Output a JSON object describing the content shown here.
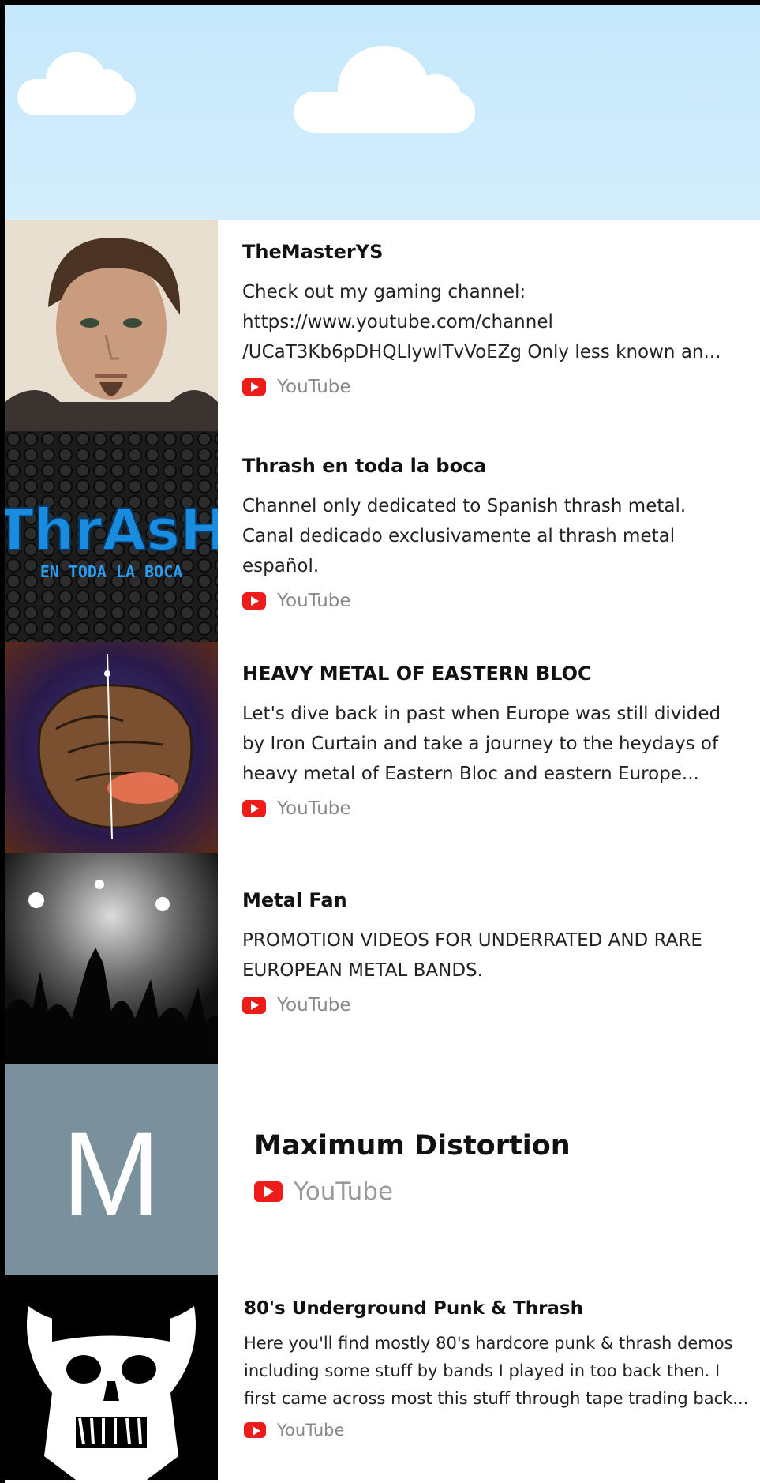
{
  "channels": [
    {
      "title": "TheMasterYS",
      "desc": [
        "Check out my gaming channel:",
        "https://www.youtube.com/channel",
        "/UCaT3Kb6pDHQLlywlTvVoEZg Only less known an..."
      ],
      "source": "YouTube"
    },
    {
      "title": "Thrash en toda la boca",
      "desc": [
        "Channel only dedicated to Spanish thrash metal.",
        "Canal dedicado exclusivamente al thrash metal",
        "español."
      ],
      "source": "YouTube",
      "logo_text": "ThrAsH",
      "logo_sub": "EN TODA LA BOCA"
    },
    {
      "title": "HEAVY METAL OF EASTERN BLOC",
      "desc": [
        "Let's dive back in past when Europe was still divided",
        "by Iron Curtain and take a journey to the heydays of",
        "heavy metal of Eastern Bloc and eastern Europe..."
      ],
      "source": "YouTube"
    },
    {
      "title": "Metal Fan",
      "desc": [
        "PROMOTION VIDEOS FOR UNDERRATED AND RARE",
        "EUROPEAN METAL BANDS."
      ],
      "source": "YouTube"
    },
    {
      "title": "Maximum Distortion",
      "source": "YouTube",
      "avatar_letter": "M"
    },
    {
      "title": "80's Underground Punk & Thrash",
      "desc": [
        "Here you'll find mostly 80's hardcore punk & thrash demos",
        "including some stuff by bands I played in too back then. I",
        "first came across most this stuff through tape trading back..."
      ],
      "source": "YouTube"
    }
  ],
  "colors": {
    "sky": "#c5e8fb",
    "youtube_red": "#ee1b1b",
    "avatar_bg": "#7a909c"
  }
}
